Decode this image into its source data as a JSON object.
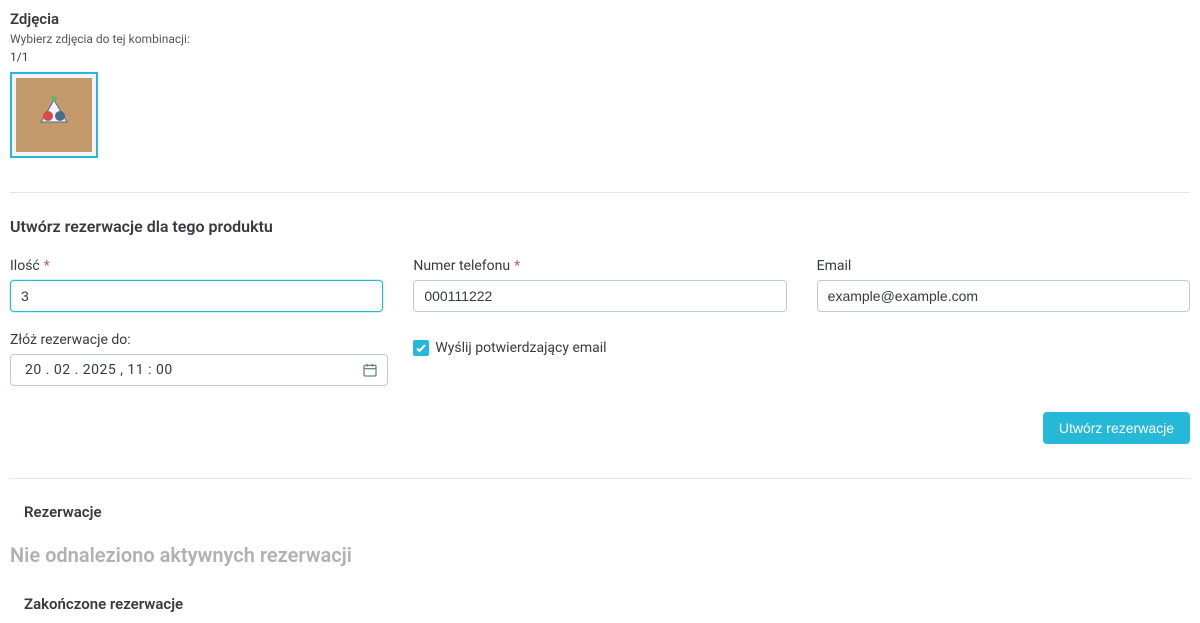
{
  "photos": {
    "title": "Zdjęcia",
    "helper": "Wybierz zdjęcia do tej kombinacji:",
    "counter": "1/1"
  },
  "reservation_form": {
    "heading": "Utwórz rezerwacje dla tego produktu",
    "qty": {
      "label": "Ilość",
      "value": "3"
    },
    "phone": {
      "label": "Numer telefonu",
      "value": "000111222"
    },
    "email": {
      "label": "Email",
      "value": "example@example.com"
    },
    "deadline": {
      "label": "Złóż rezerwacje do:",
      "value": "20 . 02 . 2025 ,  11 : 00"
    },
    "confirm_checkbox": {
      "label": "Wyślij potwierdzający email",
      "checked": true
    },
    "submit": "Utwórz rezerwacje"
  },
  "reservations": {
    "heading": "Rezerwacje",
    "empty": "Nie odnaleziono aktywnych rezerwacji",
    "completed_heading": "Zakończone rezerwacje"
  }
}
